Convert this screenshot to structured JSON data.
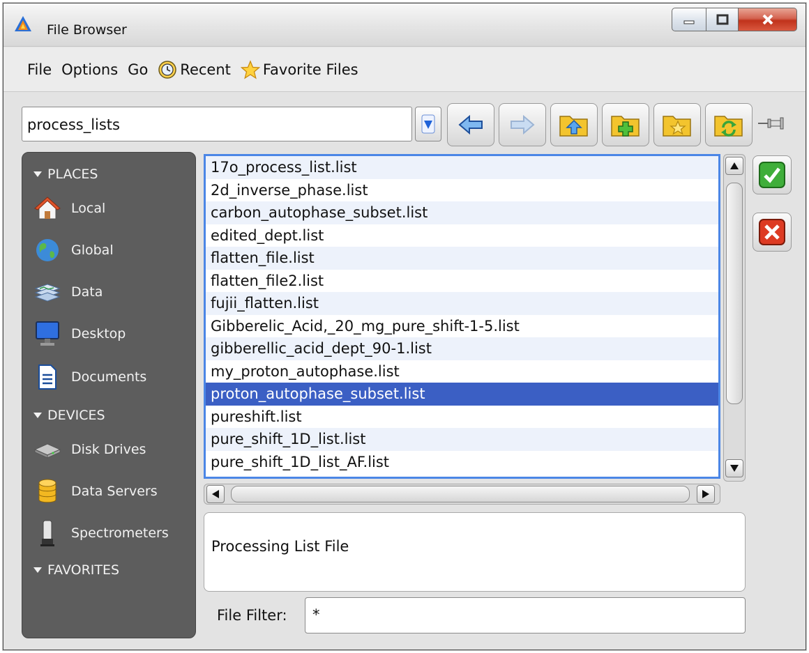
{
  "window": {
    "title": "File Browser"
  },
  "menu": {
    "file": "File",
    "options": "Options",
    "go": "Go",
    "recent": "Recent",
    "favorite_files": "Favorite Files"
  },
  "path": {
    "value": "process_lists"
  },
  "toolbar_icons": [
    "chevron-down-icon",
    "back-arrow-icon",
    "forward-arrow-icon",
    "folder-up-icon",
    "folder-new-icon",
    "folder-favorite-icon",
    "folder-refresh-icon",
    "pin-icon"
  ],
  "sidebar": {
    "places_header": "PLACES",
    "places": [
      {
        "label": "Local",
        "icon": "home-icon"
      },
      {
        "label": "Global",
        "icon": "globe-icon"
      },
      {
        "label": "Data",
        "icon": "data-stack-icon"
      },
      {
        "label": "Desktop",
        "icon": "monitor-icon"
      },
      {
        "label": "Documents",
        "icon": "document-icon"
      }
    ],
    "devices_header": "DEVICES",
    "devices": [
      {
        "label": "Disk Drives",
        "icon": "disk-drive-icon"
      },
      {
        "label": "Data Servers",
        "icon": "database-icon"
      },
      {
        "label": "Spectrometers",
        "icon": "spectrometer-icon"
      }
    ],
    "favorites_header": "FAVORITES"
  },
  "files": [
    "17o_process_list.list",
    "2d_inverse_phase.list",
    "carbon_autophase_subset.list",
    "edited_dept.list",
    "flatten_file.list",
    "flatten_file2.list",
    "fujii_flatten.list",
    "Gibberelic_Acid,_20_mg_pure_shift-1-5.list",
    "gibberellic_acid_dept_90-1.list",
    "my_proton_autophase.list",
    "proton_autophase_subset.list",
    "pureshift.list",
    "pure_shift_1D_list.list",
    "pure_shift_1D_list_AF.list"
  ],
  "selected_file": "proton_autophase_subset.list",
  "description": "Processing List File",
  "filter": {
    "label": "File Filter:",
    "value": "*"
  },
  "colors": {
    "selection": "#3b5fc4",
    "list_border": "#4b86e6",
    "sidebar": "#5d5d5d"
  }
}
